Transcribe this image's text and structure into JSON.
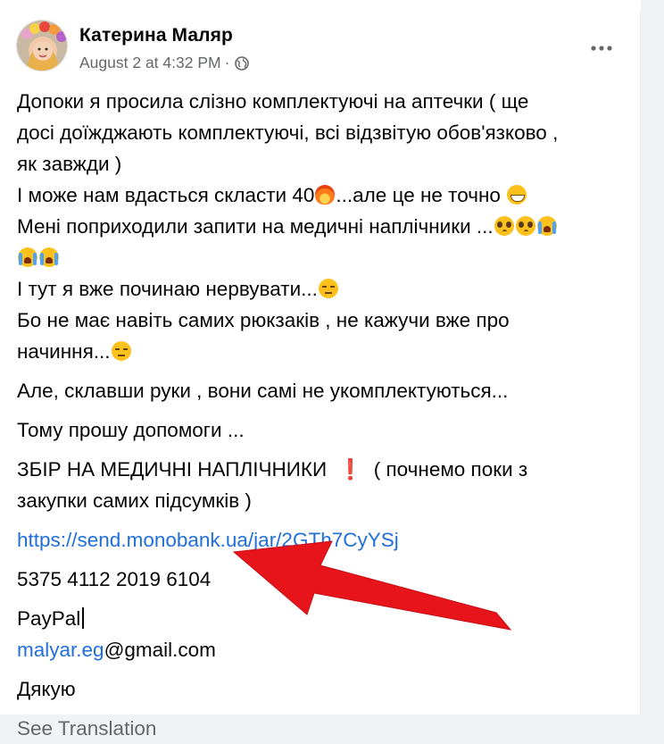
{
  "post": {
    "author": "Катерина Маляр",
    "timestamp": "August 2 at 4:32 PM",
    "separator": "·",
    "privacy_icon": "globe-icon",
    "more_icon": "more-horizontal-icon",
    "lines": {
      "l1": "Допоки я просила слізно комплектуючі на аптечки ( ще",
      "l2": "досі доїжджають комплектуючі, всі відзвітую обов'язково ,",
      "l3": "як завжди  )",
      "l4a": "І може нам вдасться скласти 40",
      "l4b": "...але це не точно",
      "l5": "Мені поприходили запити на медичні наплічники ...",
      "l6": "І тут я вже починаю нервувати...",
      "l7": "Бо не має навіть самих рюкзаків , не кажучи вже про",
      "l8": "начиння...",
      "p2": "Але,  склавши руки , вони самі не укомплектуються...",
      "p3": "Тому прошу допомоги ...",
      "p4a": "ЗБІР НА МЕДИЧНІ НАПЛІЧНИКИ",
      "p4_excl": "❗",
      "p4b": "( почнемо поки з",
      "p4c": "закупки самих підсумків )",
      "monobank_link": "https://send.monobank.ua/jar/2GTh7CyYSj",
      "card_number": "5375 4112 2019 6104",
      "paypal_label": "PayPal",
      "email_link": "malyar.eg",
      "email_domain": "@gmail.com",
      "thanks": "Дякую"
    },
    "see_translation": "See Translation"
  },
  "colors": {
    "link": "#216fdb",
    "meta": "#65676b",
    "arrow": "#e8141c"
  }
}
